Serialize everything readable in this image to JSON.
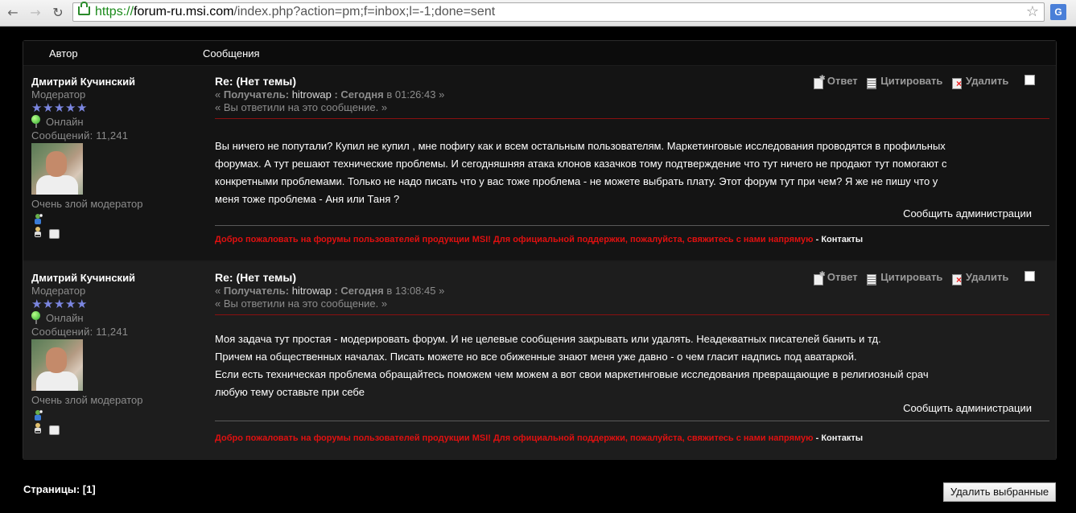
{
  "browser": {
    "url_scheme": "https://",
    "url_host": "forum-ru.msi.com",
    "url_path": "/index.php?action=pm;f=inbox;l=-1;done=sent"
  },
  "table": {
    "col_author": "Автор",
    "col_messages": "Сообщения"
  },
  "posts": [
    {
      "author": "Дмитрий Кучинский",
      "role": "Модератор",
      "status": "Онлайн",
      "post_count": "Сообщений: 11,241",
      "personal_text": "Очень злой модератор",
      "subject": "Re: (Нет темы)",
      "meta_prefix": "« ",
      "recipient_label": "Получатель:",
      "recipient": "hitrowap",
      "date_sep": " : ",
      "date_label": "Сегодня",
      "time_prefix": " в ",
      "time": "01:26:43",
      "meta_suffix": " »",
      "replied_note": "« Вы ответили на это сообщение. »",
      "body_lines": [
        "Вы ничего не попутали?  Купил не купил , мне пофигу как и всем остальным пользователям. Маркетинговые исследования проводятся в профильных",
        "форумах. А тут решают технические проблемы. И сегодняшняя атака клонов казачков тому подтверждение что тут ничего не продают тут помогают с",
        "конкретными проблемами. Только не надо писать что у вас тоже проблема - не можете выбрать плату. Этот форум тут при чем? Я же не пишу что у",
        "меня тоже проблема - Аня или Таня  ?"
      ],
      "report": "Сообщить администрации",
      "signature_red": "Добро пожаловать на форумы пользователей продукции MSI! Для официальной поддержки, пожалуйста, свяжитесь с нами напрямую",
      "signature_sep": " - ",
      "signature_link": "Контакты"
    },
    {
      "author": "Дмитрий Кучинский",
      "role": "Модератор",
      "status": "Онлайн",
      "post_count": "Сообщений: 11,241",
      "personal_text": "Очень злой модератор",
      "subject": "Re: (Нет темы)",
      "meta_prefix": "« ",
      "recipient_label": "Получатель:",
      "recipient": "hitrowap",
      "date_sep": " : ",
      "date_label": "Сегодня",
      "time_prefix": " в ",
      "time": "13:08:45",
      "meta_suffix": " »",
      "replied_note": "« Вы ответили на это сообщение. »",
      "body_lines": [
        "Моя задача тут простая - модерировать форум.  И не целевые сообщения закрывать или удалять. Неадекватных писателей банить и тд.",
        "Причем на общественных началах. Писать можете но все обиженные знают меня уже давно - о чем гласит надпись под аватаркой.",
        "Если есть техническая проблема обращайтесь поможем чем можем а вот свои маркетинговые исследования превращающие в религиозный срач",
        "любую тему оставьте при себе"
      ],
      "report": "Сообщить администрации",
      "signature_red": "Добро пожаловать на форумы пользователей продукции MSI! Для официальной поддержки, пожалуйста, свяжитесь с нами напрямую",
      "signature_sep": " - ",
      "signature_link": "Контакты"
    }
  ],
  "actions": {
    "reply": "Ответ",
    "quote": "Цитировать",
    "delete": "Удалить"
  },
  "footer": {
    "pages": "Страницы: [1]",
    "delete_selected": "Удалить выбранные"
  },
  "colors": {
    "background": "#000000",
    "panel": "#1c1c1c",
    "signature_red": "#e01010",
    "separator_red": "#8a1010"
  }
}
